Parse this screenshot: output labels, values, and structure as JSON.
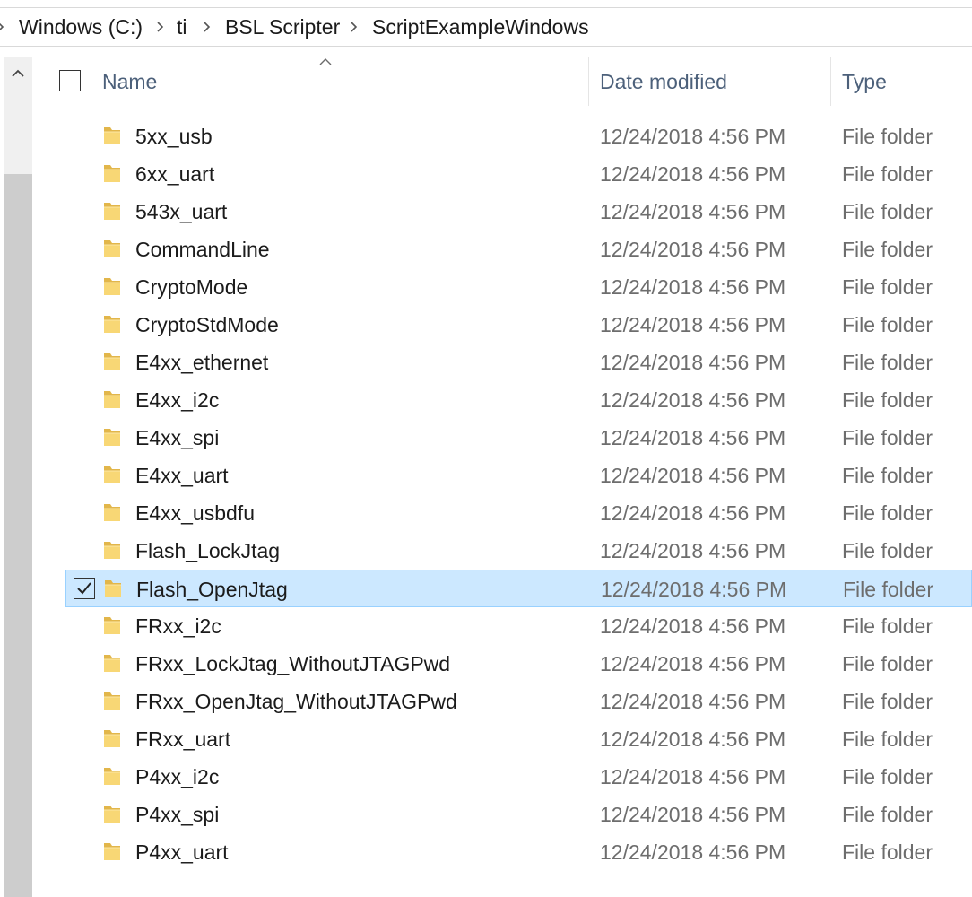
{
  "breadcrumb": [
    "Windows (C:)",
    "ti",
    "BSL Scripter",
    "ScriptExampleWindows"
  ],
  "columns": {
    "name": "Name",
    "date": "Date modified",
    "type": "Type"
  },
  "rows": [
    {
      "name": "5xx_usb",
      "date": "12/24/2018 4:56 PM",
      "type": "File folder"
    },
    {
      "name": "6xx_uart",
      "date": "12/24/2018 4:56 PM",
      "type": "File folder"
    },
    {
      "name": "543x_uart",
      "date": "12/24/2018 4:56 PM",
      "type": "File folder"
    },
    {
      "name": "CommandLine",
      "date": "12/24/2018 4:56 PM",
      "type": "File folder"
    },
    {
      "name": "CryptoMode",
      "date": "12/24/2018 4:56 PM",
      "type": "File folder"
    },
    {
      "name": "CryptoStdMode",
      "date": "12/24/2018 4:56 PM",
      "type": "File folder"
    },
    {
      "name": "E4xx_ethernet",
      "date": "12/24/2018 4:56 PM",
      "type": "File folder"
    },
    {
      "name": "E4xx_i2c",
      "date": "12/24/2018 4:56 PM",
      "type": "File folder"
    },
    {
      "name": "E4xx_spi",
      "date": "12/24/2018 4:56 PM",
      "type": "File folder"
    },
    {
      "name": "E4xx_uart",
      "date": "12/24/2018 4:56 PM",
      "type": "File folder"
    },
    {
      "name": "E4xx_usbdfu",
      "date": "12/24/2018 4:56 PM",
      "type": "File folder"
    },
    {
      "name": "Flash_LockJtag",
      "date": "12/24/2018 4:56 PM",
      "type": "File folder"
    },
    {
      "name": "Flash_OpenJtag",
      "date": "12/24/2018 4:56 PM",
      "type": "File folder",
      "selected": true
    },
    {
      "name": "FRxx_i2c",
      "date": "12/24/2018 4:56 PM",
      "type": "File folder"
    },
    {
      "name": "FRxx_LockJtag_WithoutJTAGPwd",
      "date": "12/24/2018 4:56 PM",
      "type": "File folder"
    },
    {
      "name": "FRxx_OpenJtag_WithoutJTAGPwd",
      "date": "12/24/2018 4:56 PM",
      "type": "File folder"
    },
    {
      "name": "FRxx_uart",
      "date": "12/24/2018 4:56 PM",
      "type": "File folder"
    },
    {
      "name": "P4xx_i2c",
      "date": "12/24/2018 4:56 PM",
      "type": "File folder"
    },
    {
      "name": "P4xx_spi",
      "date": "12/24/2018 4:56 PM",
      "type": "File folder"
    },
    {
      "name": "P4xx_uart",
      "date": "12/24/2018 4:56 PM",
      "type": "File folder"
    }
  ],
  "colors": {
    "selection_bg": "#cce8ff",
    "selection_border": "#99d1ff",
    "header_text": "#4c607a",
    "secondary_text": "#6d6d6d",
    "folder": "#f8d775"
  },
  "icons": {
    "breadcrumb_separator": "chevron-right-icon",
    "scroll_up": "chevron-up-icon",
    "sort": "sort-ascending-icon",
    "folder": "folder-icon",
    "check": "check-icon"
  }
}
